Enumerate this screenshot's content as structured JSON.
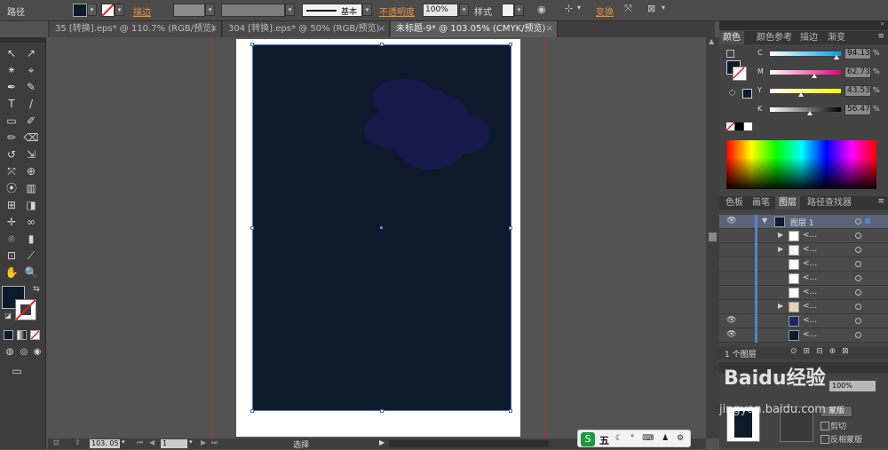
{
  "control_bar": {
    "path_label": "路径",
    "stroke_label": "描边",
    "stroke_style": "基本",
    "opacity_label": "不透明度",
    "opacity_value": "100%",
    "style_label": "样式",
    "transform_label": "变换",
    "dropdown_arrow": "▾"
  },
  "tabs": [
    {
      "label": "35 [转换].eps* @ 110.7% (RGB/预览)"
    },
    {
      "label": "304 [转换].eps* @ 50% (RGB/预览)"
    },
    {
      "label": "未标题-9* @ 103.05% (CMYK/预览)"
    }
  ],
  "tab_close": "×",
  "tools": {
    "fill_color": "#0c1a2b",
    "stroke_none_color": "#ffffff",
    "icons": [
      "↖",
      "↗",
      "✴",
      "⌖",
      "✒",
      "✎",
      "T",
      "/",
      "▭",
      "✐",
      "✏",
      "⌫",
      "↺",
      "⇲",
      "⤧",
      "⊕",
      "⦿",
      "▥",
      "⊞",
      "◨",
      "✛",
      "∞",
      "⌾",
      "▮",
      "⊡",
      "⟋",
      "✋",
      "🔍"
    ]
  },
  "canvas": {
    "artboard_color": "#ffffff",
    "rect_color": "#0c1a2b",
    "cloud_color": "#141a4a",
    "guide_color": "#b03030"
  },
  "status": {
    "zoom": "103. 05",
    "page": "1",
    "mode": "选择",
    "ime_label": "五",
    "ime_icons": "☾ ° ⌨ ♟ ⚙"
  },
  "panel": {
    "color_tabs": [
      "颜色",
      "颜色参考",
      "描边",
      "渐变"
    ],
    "cmyk": [
      {
        "label": "C",
        "value": "94.13",
        "level": 0.94
      },
      {
        "label": "M",
        "value": "62.73",
        "level": 0.63
      },
      {
        "label": "Y",
        "value": "43.53",
        "level": 0.44
      },
      {
        "label": "K",
        "value": "56.47",
        "level": 0.56
      }
    ],
    "layer_tabs": [
      "色板",
      "画笔",
      "图层",
      "路径查找器"
    ],
    "layer_main": "图层 1",
    "sublayer_name": "<...",
    "layer_count": "1 个图层",
    "mask_button": "蒙版",
    "clip_label": "剪切",
    "invert_label": "反相蒙版",
    "transparency_value": "100%"
  },
  "watermark": "Baidu经验",
  "watermark_sub": "jingyan.baidu.com"
}
